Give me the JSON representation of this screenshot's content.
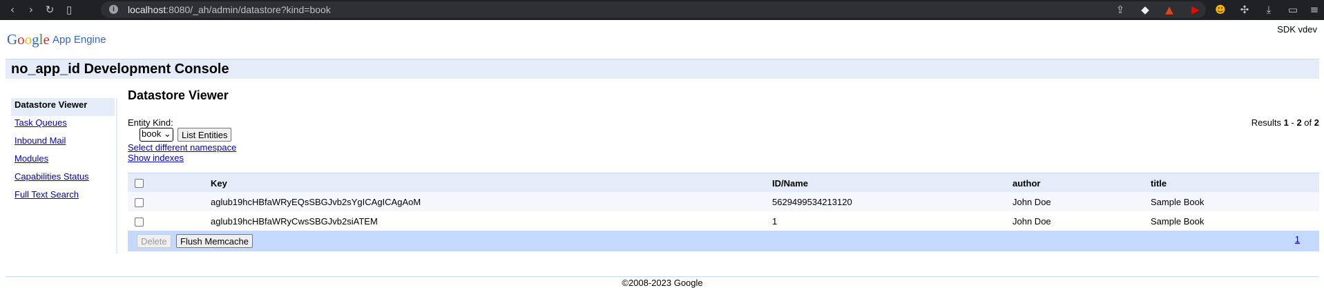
{
  "browser": {
    "url_host": "localhost",
    "url_rest": ":8080/_ah/admin/datastore?kind=book"
  },
  "header": {
    "logo": [
      "G",
      "o",
      "o",
      "g",
      "l",
      "e"
    ],
    "product": "App Engine",
    "sdk": "SDK vdev",
    "console_title": "no_app_id Development Console"
  },
  "sidebar": {
    "items": [
      {
        "label": "Datastore Viewer"
      },
      {
        "label": "Task Queues"
      },
      {
        "label": "Inbound Mail"
      },
      {
        "label": "Modules"
      },
      {
        "label": "Capabilities Status"
      },
      {
        "label": "Full Text Search"
      }
    ]
  },
  "main": {
    "title": "Datastore Viewer",
    "kind_label": "Entity Kind:",
    "kind_value": "book",
    "list_button": "List Entities",
    "namespace_link": "Select different namespace",
    "indexes_link": "Show indexes",
    "results": {
      "prefix": "Results ",
      "from": "1",
      "dash": " - ",
      "to": "2",
      "of": " of ",
      "total": "2"
    }
  },
  "table": {
    "columns": [
      "Key",
      "ID/Name",
      "author",
      "title"
    ],
    "rows": [
      {
        "key": "aglub19hcHBfaWRyEQsSBGJvb2sYgICAgICAgAoM",
        "id": "5629499534213120",
        "author": "John Doe",
        "title": "Sample Book"
      },
      {
        "key": "aglub19hcHBfaWRyCwsSBGJvb2siATEM",
        "id": "1",
        "author": "John Doe",
        "title": "Sample Book"
      }
    ],
    "delete_button": "Delete",
    "flush_button": "Flush Memcache",
    "page": "1"
  },
  "footer": {
    "copyright": "©2008-2023 Google"
  },
  "colors": {
    "link": "#0000cc",
    "header_bg": "#e5ecf9",
    "accent": "#c3d9ff"
  }
}
